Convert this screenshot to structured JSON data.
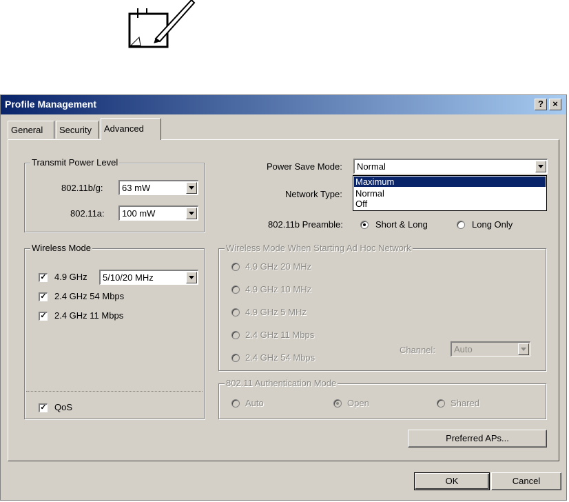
{
  "window": {
    "title": "Profile Management",
    "help_button": "?",
    "close_button": "×"
  },
  "tabs": [
    {
      "label": "General",
      "active": false
    },
    {
      "label": "Security",
      "active": false
    },
    {
      "label": "Advanced",
      "active": true
    }
  ],
  "transmit_power": {
    "legend": "Transmit Power Level",
    "b_g_label": "802.11b/g:",
    "b_g_value": "63 mW",
    "a_label": "802.11a:",
    "a_value": "100 mW"
  },
  "power_save": {
    "label": "Power Save Mode:",
    "value": "Normal",
    "options": [
      "Maximum",
      "Normal",
      "Off"
    ],
    "highlighted": "Maximum"
  },
  "network_type": {
    "label": "Network Type:"
  },
  "preamble": {
    "label": "802.11b Preamble:",
    "options": [
      {
        "label": "Short & Long",
        "selected": true
      },
      {
        "label": "Long Only",
        "selected": false
      }
    ]
  },
  "wireless_mode": {
    "legend": "Wireless Mode",
    "items": [
      {
        "label": "4.9 GHz",
        "checked": true
      },
      {
        "label": "2.4 GHz 54 Mbps",
        "checked": true
      },
      {
        "label": "2.4 GHz 11 Mbps",
        "checked": true
      }
    ],
    "ghz49_bandwidth": "5/10/20 MHz",
    "qos_label": "QoS",
    "qos_checked": true
  },
  "adhoc_mode": {
    "legend": "Wireless Mode When Starting Ad Hoc Network",
    "options": [
      "4.9 GHz 20 MHz",
      "4.9 GHz 10 MHz",
      "4.9 GHz 5 MHz",
      "2.4 GHz 11 Mbps",
      "2.4 GHz 54 Mbps"
    ],
    "channel_label": "Channel:",
    "channel_value": "Auto"
  },
  "auth_mode": {
    "legend": "802.11 Authentication Mode",
    "options": [
      {
        "label": "Auto",
        "selected": false
      },
      {
        "label": "Open",
        "selected": true
      },
      {
        "label": "Shared",
        "selected": false
      }
    ]
  },
  "buttons": {
    "preferred_aps": "Preferred APs...",
    "ok": "OK",
    "cancel": "Cancel"
  },
  "icons": {
    "note": "note-pencil-icon",
    "check": "✓"
  }
}
